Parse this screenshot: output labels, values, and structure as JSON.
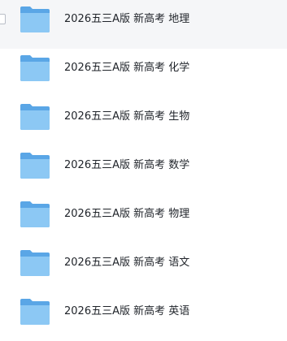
{
  "file_list": {
    "items": [
      {
        "name": "2026五三A版 新高考 地理",
        "icon": "folder-icon",
        "hovered": true
      },
      {
        "name": "2026五三A版 新高考 化学",
        "icon": "folder-icon",
        "hovered": false
      },
      {
        "name": "2026五三A版 新高考 生物",
        "icon": "folder-icon",
        "hovered": false
      },
      {
        "name": "2026五三A版 新高考 数学",
        "icon": "folder-icon",
        "hovered": false
      },
      {
        "name": "2026五三A版 新高考 物理",
        "icon": "folder-icon",
        "hovered": false
      },
      {
        "name": "2026五三A版 新高考 语文",
        "icon": "folder-icon",
        "hovered": false
      },
      {
        "name": "2026五三A版 新高考 英语",
        "icon": "folder-icon",
        "hovered": false
      }
    ]
  },
  "colors": {
    "folder_back": "#5aa6e6",
    "folder_front": "#8cc8f4",
    "hover_background": "#f5f6f8",
    "text": "#1f2329"
  }
}
